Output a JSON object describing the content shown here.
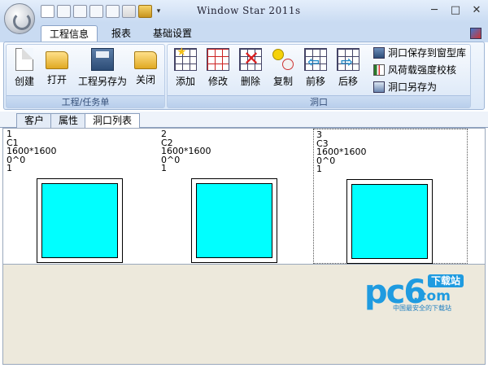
{
  "window": {
    "title": "Window Star 2011s",
    "minimize": "─",
    "restore": "□",
    "close": "✕"
  },
  "qat": {
    "dropdown": "▾"
  },
  "tabs": [
    {
      "label": "工程信息",
      "active": true
    },
    {
      "label": "报表",
      "active": false
    },
    {
      "label": "基础设置",
      "active": false
    }
  ],
  "ribbon": {
    "project_group": {
      "label": "工程/任务单",
      "buttons": [
        {
          "label": "创建",
          "icon": "new-document-icon"
        },
        {
          "label": "打开",
          "icon": "open-folder-icon"
        },
        {
          "label": "工程另存为",
          "icon": "save-as-icon"
        },
        {
          "label": "关闭",
          "icon": "close-folder-icon"
        }
      ]
    },
    "opening_group": {
      "label": "洞口",
      "buttons": [
        {
          "label": "添加",
          "icon": "add-icon"
        },
        {
          "label": "修改",
          "icon": "edit-icon"
        },
        {
          "label": "删除",
          "icon": "delete-icon"
        },
        {
          "label": "复制",
          "icon": "copy-icon"
        },
        {
          "label": "前移",
          "icon": "move-forward-icon"
        },
        {
          "label": "后移",
          "icon": "move-back-icon"
        }
      ],
      "side_items": [
        {
          "label": "洞口保存到窗型库",
          "icon": "save-to-library-icon"
        },
        {
          "label": "风荷载强度校核",
          "icon": "wind-load-icon"
        },
        {
          "label": "洞口另存为",
          "icon": "opening-save-as-icon"
        }
      ]
    }
  },
  "doc_tabs": [
    {
      "label": "客户",
      "active": false
    },
    {
      "label": "属性",
      "active": false
    },
    {
      "label": "洞口列表",
      "active": true
    }
  ],
  "openings": [
    {
      "index": "1",
      "code": "C1",
      "size": "1600*1600",
      "angle": "0^0",
      "qty": "1",
      "selected": false
    },
    {
      "index": "2",
      "code": "C2",
      "size": "1600*1600",
      "angle": "0^0",
      "qty": "1",
      "selected": false
    },
    {
      "index": "3",
      "code": "C3",
      "size": "1600*1600",
      "angle": "0^0",
      "qty": "1",
      "selected": true
    }
  ],
  "watermark": {
    "brand": "pc6",
    "domain": ".com",
    "badge": "下载站",
    "slogan": "中国最安全的下载站"
  },
  "colors": {
    "glass": "#00ffff",
    "brand": "#1f9be0"
  }
}
